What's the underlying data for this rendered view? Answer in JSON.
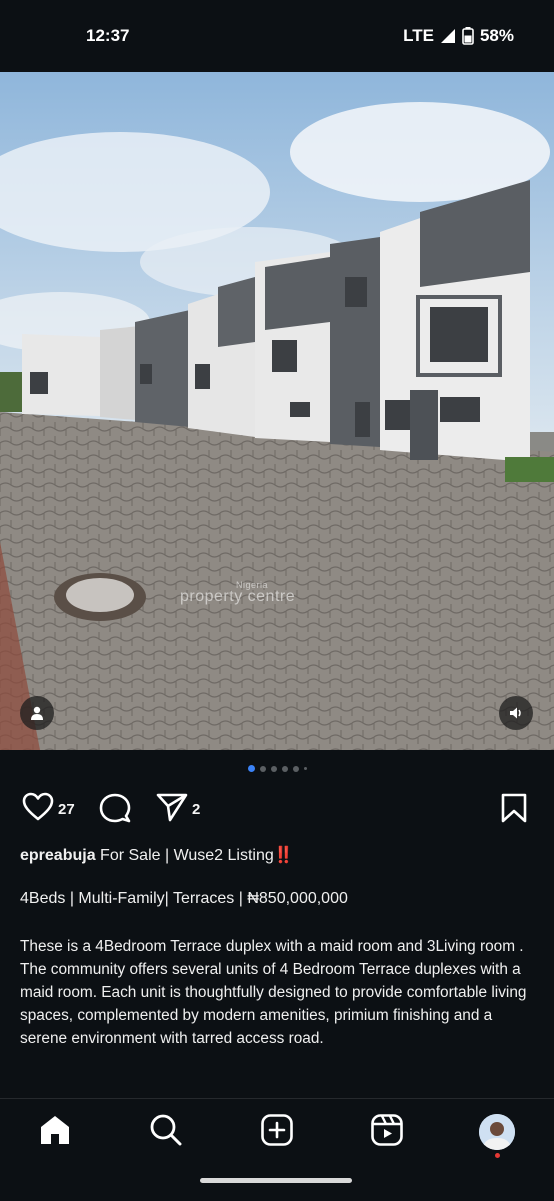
{
  "status": {
    "time": "12:37",
    "network": "LTE",
    "battery": "58%"
  },
  "post": {
    "carousel_total": 6,
    "carousel_index": 1,
    "watermark_top": "Nigeria",
    "watermark": "property centre",
    "likes": "27",
    "shares": "2",
    "username": "epreabuja",
    "title": "For Sale | Wuse2 Listing",
    "title_emoji": "‼️",
    "tagline": "4Beds | Multi-Family| Terraces | ₦850,000,000",
    "description": "These is a 4Bedroom Terrace duplex with a maid room and 3Living room . The community offers several units of 4 Bedroom Terrace duplexes with a maid room. Each unit is thoughtfully designed to provide comfortable living spaces, complemented by modern amenities, primium finishing and a serene environment with tarred access road."
  },
  "nav": {
    "items": [
      "home-icon",
      "search-icon",
      "create-icon",
      "reels-icon",
      "profile-avatar"
    ]
  },
  "colors": {
    "background": "#0c1014",
    "accent": "#3b82f6",
    "alert": "#e53935"
  }
}
